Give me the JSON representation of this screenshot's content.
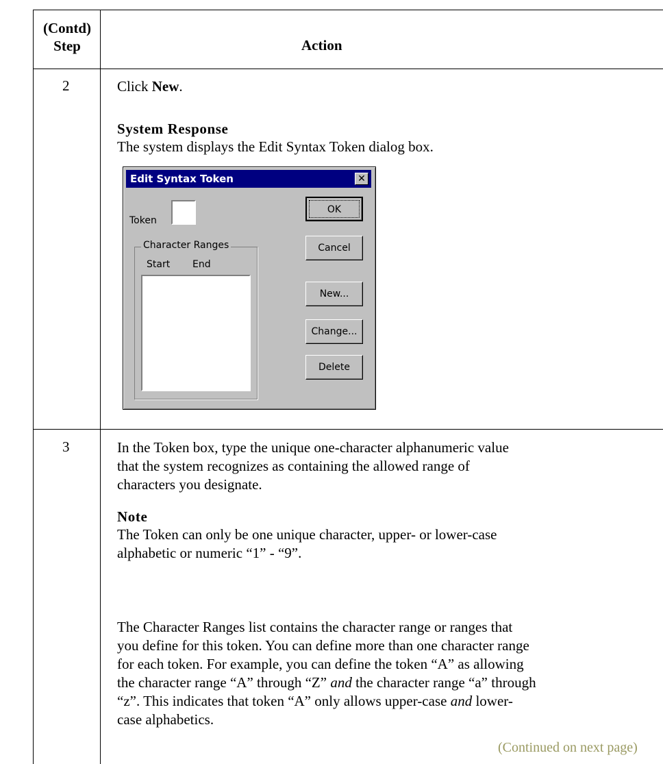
{
  "table": {
    "header": {
      "step_line1": "(Contd)",
      "step_line2": "Step",
      "action": "Action"
    },
    "rows": [
      {
        "step": "2",
        "click_prefix": "Click ",
        "click_target": "New",
        "click_suffix": ".",
        "response_heading": "System Response",
        "response_text": "The system displays the Edit Syntax Token dialog box."
      },
      {
        "step": "3",
        "paragraph1": "In the Token box, type the unique one-character alphanumeric value that the system recognizes as containing the allowed range of characters you designate.",
        "note_heading": "Note",
        "note_text": "The Token can only be one unique character, upper- or lower-case alphabetic or numeric “1” - “9”.",
        "p2_a": "The Character Ranges list contains the character range or ranges that you define for this token. You can define more than one character range for each token. For example, you can define the token “A” as allowing the character range “A” through “Z” ",
        "p2_and1": "and",
        "p2_b": " the character range “a” through “z”. This indicates that token “A” only allows upper-case ",
        "p2_and2": "and",
        "p2_c": " lower-case alphabetics."
      }
    ]
  },
  "dialog": {
    "title": "Edit Syntax Token",
    "close_glyph": "✕",
    "token_label": "Token",
    "token_value": "",
    "group_label": "Character Ranges",
    "col_start": "Start",
    "col_end": "End",
    "buttons": {
      "ok": "OK",
      "cancel": "Cancel",
      "new": "New...",
      "change": "Change...",
      "delete": "Delete"
    }
  },
  "footer": {
    "continued": "(Continued on next page)"
  },
  "colors": {
    "titlebar": "#000080",
    "dialog_face": "#c0c0c0",
    "continued_text": "#9a9a62"
  }
}
